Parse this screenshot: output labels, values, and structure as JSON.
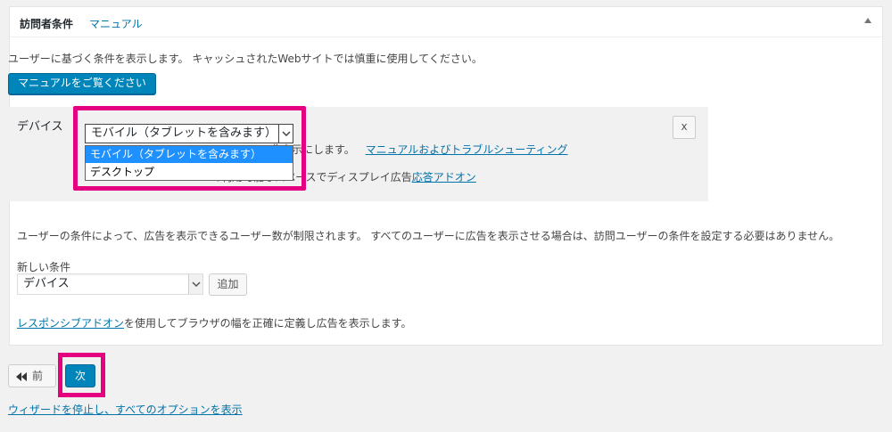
{
  "panel": {
    "title": "訪問者条件",
    "manual_link": "マニュアル",
    "description": "ユーザーに基づく条件を表示します。 キャッシュされたWebサイトでは慎重に使用してください。",
    "manual_button": "マニュアルをご覧ください"
  },
  "condition": {
    "label": "デバイス",
    "remove_button": "x",
    "select_value": "モバイル（タブレットを含みます）",
    "dropdown_options": [
      "モバイル（タブレットを含みます）",
      "デスクトップ"
    ],
    "text1_prefix": "非表示にします。",
    "text1_link": "マニュアルおよびトラブルシューティング",
    "text2_prefix": "で利用可能なスペースでディスプレイ広告",
    "text2_link": "応答アドオン"
  },
  "notice": "ユーザーの条件によって、広告を表示できるユーザー数が制限されます。 すべてのユーザーに広告を表示させる場合は、訪問ユーザーの条件を設定する必要はありません。",
  "new_condition": {
    "label": "新しい条件",
    "select_value": "デバイス",
    "add_button": "追加"
  },
  "footer": {
    "link": "レスポンシブアドオン",
    "text": "を使用してブラウザの幅を正確に定義し広告を表示します。"
  },
  "nav": {
    "prev_label": "前",
    "next_label": "次",
    "stop_link": "ウィザードを停止し、すべてのオプションを表示"
  },
  "colors": {
    "highlight": "#e4007f",
    "primary": "#0085ba",
    "dropdown_selected": "#1e90ff"
  }
}
